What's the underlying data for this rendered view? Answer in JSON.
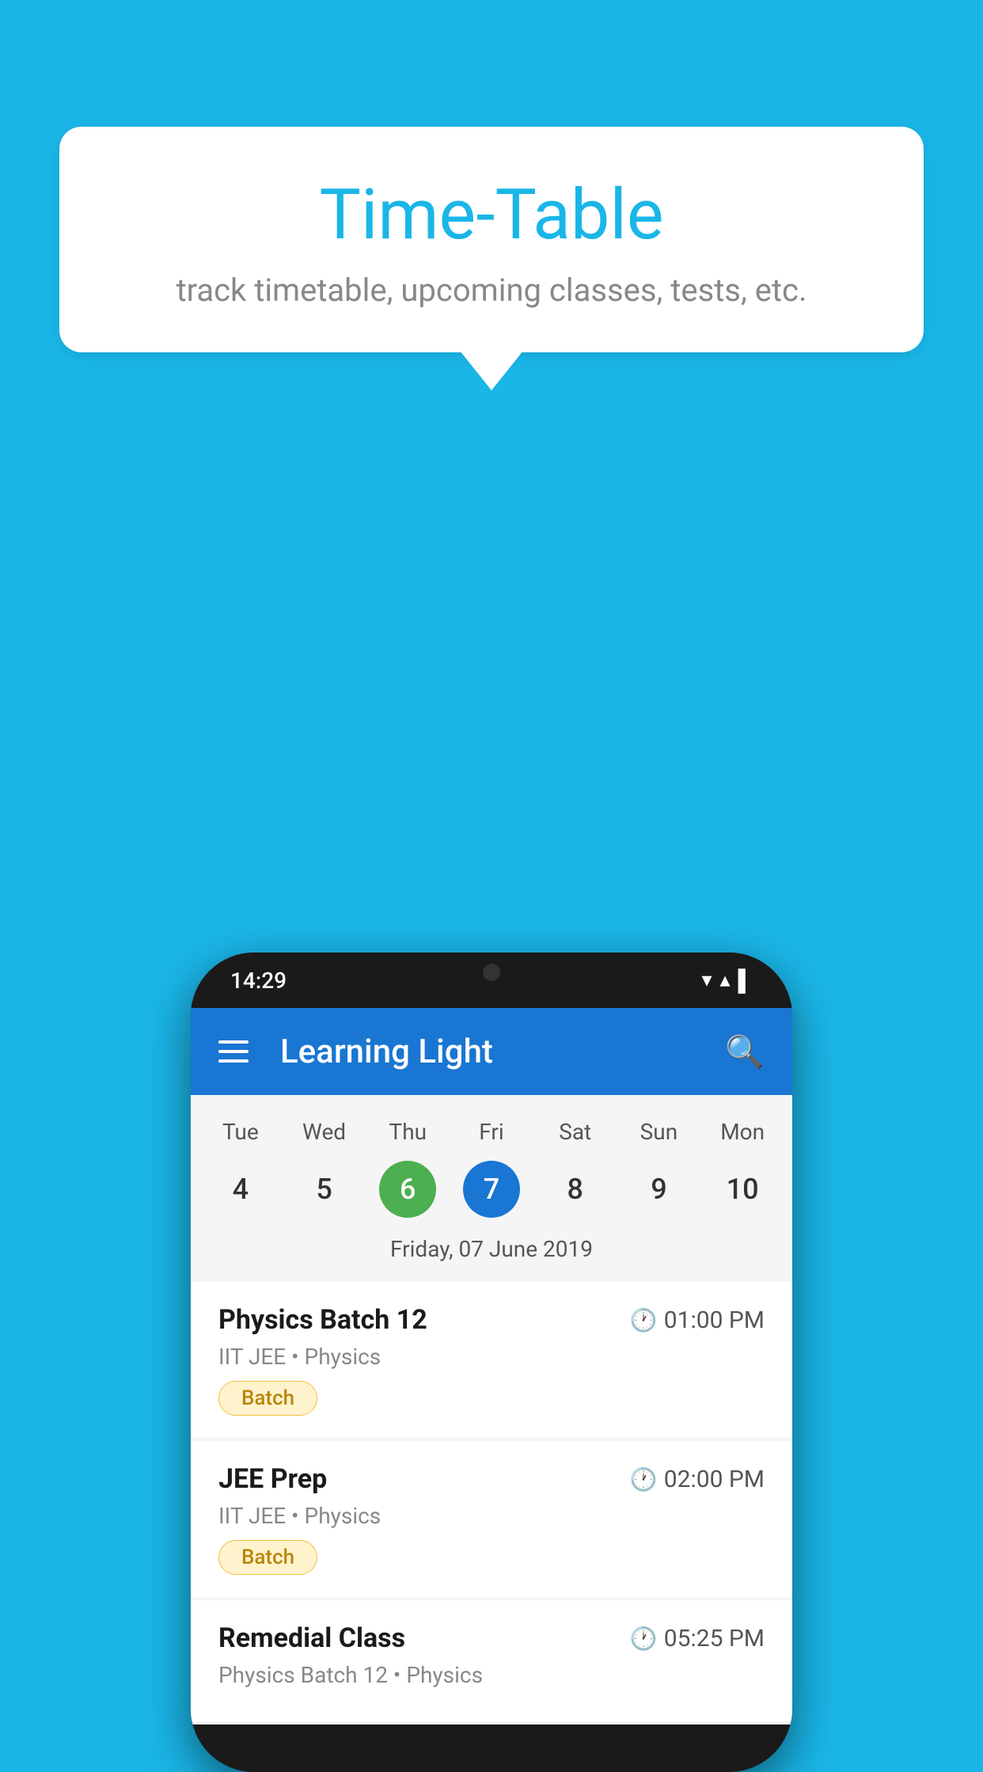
{
  "background_color": "#1ab6e8",
  "bubble": {
    "title": "Time-Table",
    "subtitle": "track timetable, upcoming classes, tests, etc."
  },
  "phone": {
    "time": "14:29",
    "app_bar": {
      "title": "Learning Light",
      "menu_icon": "hamburger-icon",
      "search_icon": "search-icon"
    },
    "calendar": {
      "days": [
        "Tue",
        "Wed",
        "Thu",
        "Fri",
        "Sat",
        "Sun",
        "Mon"
      ],
      "dates": [
        "4",
        "5",
        "6",
        "7",
        "8",
        "9",
        "10"
      ],
      "today_index": 2,
      "selected_index": 3,
      "selected_date_label": "Friday, 07 June 2019"
    },
    "schedule": [
      {
        "name": "Physics Batch 12",
        "time": "01:00 PM",
        "meta": "IIT JEE • Physics",
        "badge": "Batch"
      },
      {
        "name": "JEE Prep",
        "time": "02:00 PM",
        "meta": "IIT JEE • Physics",
        "badge": "Batch"
      },
      {
        "name": "Remedial Class",
        "time": "05:25 PM",
        "meta": "Physics Batch 12 • Physics",
        "badge": null
      }
    ]
  }
}
